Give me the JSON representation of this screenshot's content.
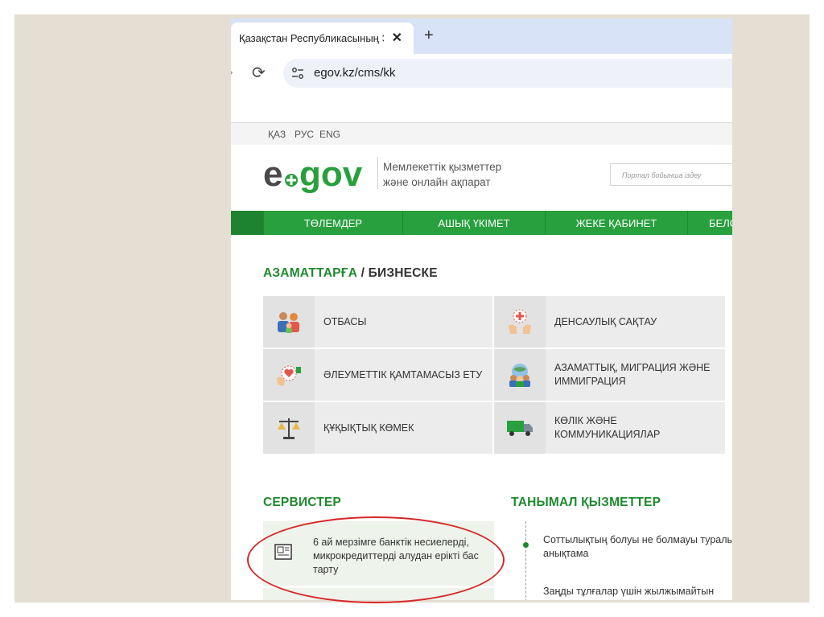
{
  "browser": {
    "tab_title": "Қазақстан Республикасының Э",
    "tab_close": "✕",
    "new_tab": "+",
    "url": "egov.kz/cms/kk",
    "reload_glyph": "⟳"
  },
  "site": {
    "languages": [
      "ҚАЗ",
      "РУС",
      "ENG"
    ],
    "logo_text": "egov",
    "tagline_line1": "Мемлекеттік қызметтер",
    "tagline_line2": "және онлайн ақпарат",
    "search_placeholder": "Портал бойынша іздеу",
    "nav": [
      "ТӨЛЕМДЕР",
      "АШЫҚ ҮКІМЕТ",
      "ЖЕКЕ ҚАБИНЕТ",
      "БЕЛС"
    ],
    "section_title_a": "АЗАМАТТАРҒА",
    "section_title_sep": " / ",
    "section_title_b": "БИЗНЕСКЕ",
    "categories": [
      {
        "label": "ОТБАСЫ",
        "icon": "family-icon"
      },
      {
        "label": "ДЕНСАУЛЫҚ САҚТАУ",
        "icon": "health-icon"
      },
      {
        "label": "ӘЛЕУМЕТТІК ҚАМТАМАСЫЗ ЕТУ",
        "icon": "social-care-icon"
      },
      {
        "label": "АЗАМАТТЫҚ, МИГРАЦИЯ ЖӘНЕ ИММИГРАЦИЯ",
        "icon": "migration-icon"
      },
      {
        "label": "ҚҰҚЫҚТЫҚ КӨМЕК",
        "icon": "legal-scales-icon"
      },
      {
        "label": "КӨЛІК ЖӘНЕ КОММУНИКАЦИЯЛАР",
        "icon": "truck-icon"
      }
    ],
    "services_title": "СЕРВИСТЕР",
    "services": [
      "6 ай мерзімге банктік несиелерді, микрокредиттерді алудан ерікті бас тарту"
    ],
    "popular_title": "ТАНЫМАЛ ҚЫЗМЕТТЕР",
    "popular": [
      "Соттылықтың болуы не болмауы туралы анықтама",
      "Заңды тұлғалар үшін жылжымайтын"
    ]
  },
  "colors": {
    "brand_green": "#28a03d",
    "highlight_red": "#d62828",
    "background": "#e5dfd3"
  }
}
